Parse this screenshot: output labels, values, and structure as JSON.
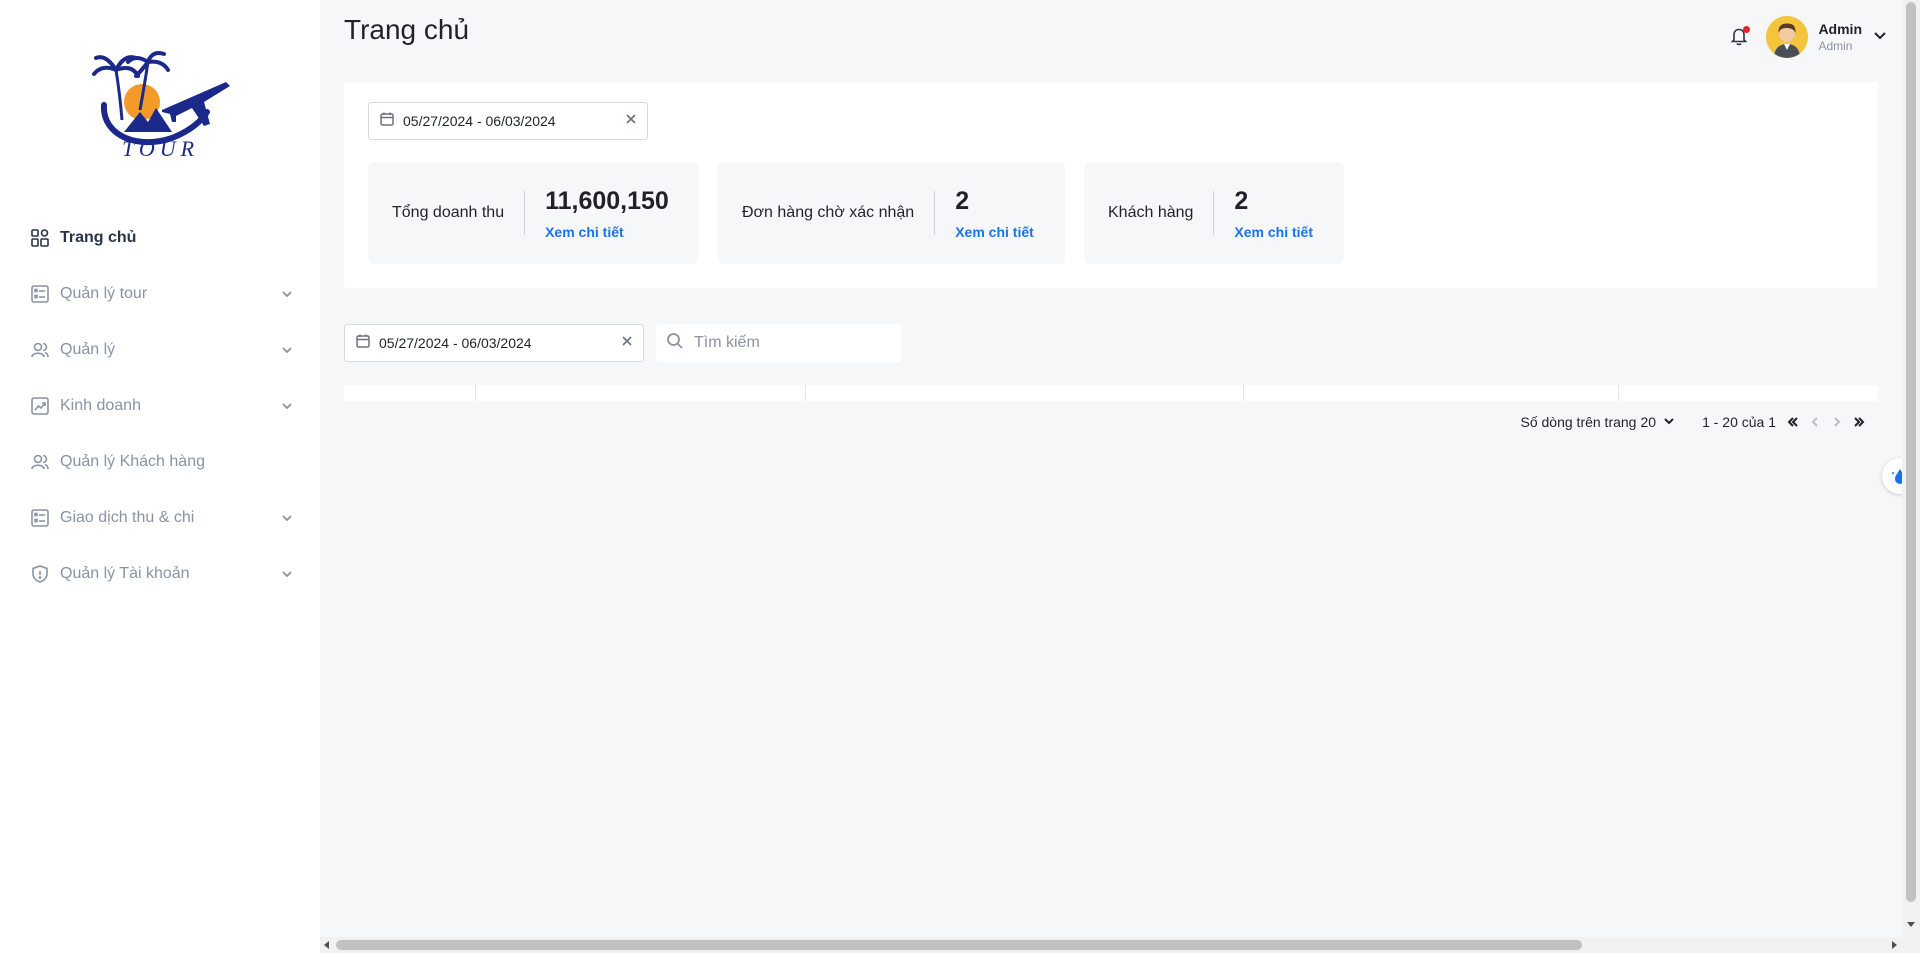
{
  "brand": {
    "logo_text": "TOUR"
  },
  "sidebar": {
    "items": [
      {
        "label": "Trang chủ",
        "icon": "dashboard-icon",
        "active": true,
        "expandable": false
      },
      {
        "label": "Quản lý tour",
        "icon": "list-icon",
        "active": false,
        "expandable": true
      },
      {
        "label": "Quản lý",
        "icon": "users-icon",
        "active": false,
        "expandable": true
      },
      {
        "label": "Kinh doanh",
        "icon": "chart-icon",
        "active": false,
        "expandable": true
      },
      {
        "label": "Quản lý Khách hàng",
        "icon": "users-icon",
        "active": false,
        "expandable": false
      },
      {
        "label": "Giao dịch thu & chi",
        "icon": "list-icon",
        "active": false,
        "expandable": true
      },
      {
        "label": "Quản lý Tài khoản",
        "icon": "shield-icon",
        "active": false,
        "expandable": true
      }
    ]
  },
  "header": {
    "title": "Trang chủ",
    "user": {
      "name": "Admin",
      "role": "Admin"
    },
    "notification_dot_color": "#e5232b"
  },
  "stats": {
    "date_range": "05/27/2024 - 06/03/2024",
    "cards": [
      {
        "label": "Tổng doanh thu",
        "value": "11,600,150",
        "link": "Xem chi tiết"
      },
      {
        "label": "Đơn hàng chờ xác nhận",
        "value": "2",
        "link": "Xem chi tiết"
      },
      {
        "label": "Khách hàng",
        "value": "2",
        "link": "Xem chi tiết"
      }
    ]
  },
  "filters": {
    "date_range": "05/27/2024 - 06/03/2024",
    "search_placeholder": "Tìm kiếm"
  },
  "pagination": {
    "rows_per_page_label": "Số dòng trên trang",
    "rows_per_page": "20",
    "range_text": "1 - 20 của 1"
  },
  "colors": {
    "accent": "#1a73e8",
    "text": "#1f2329",
    "muted": "#8a93a3",
    "background": "#f6f7f9"
  }
}
